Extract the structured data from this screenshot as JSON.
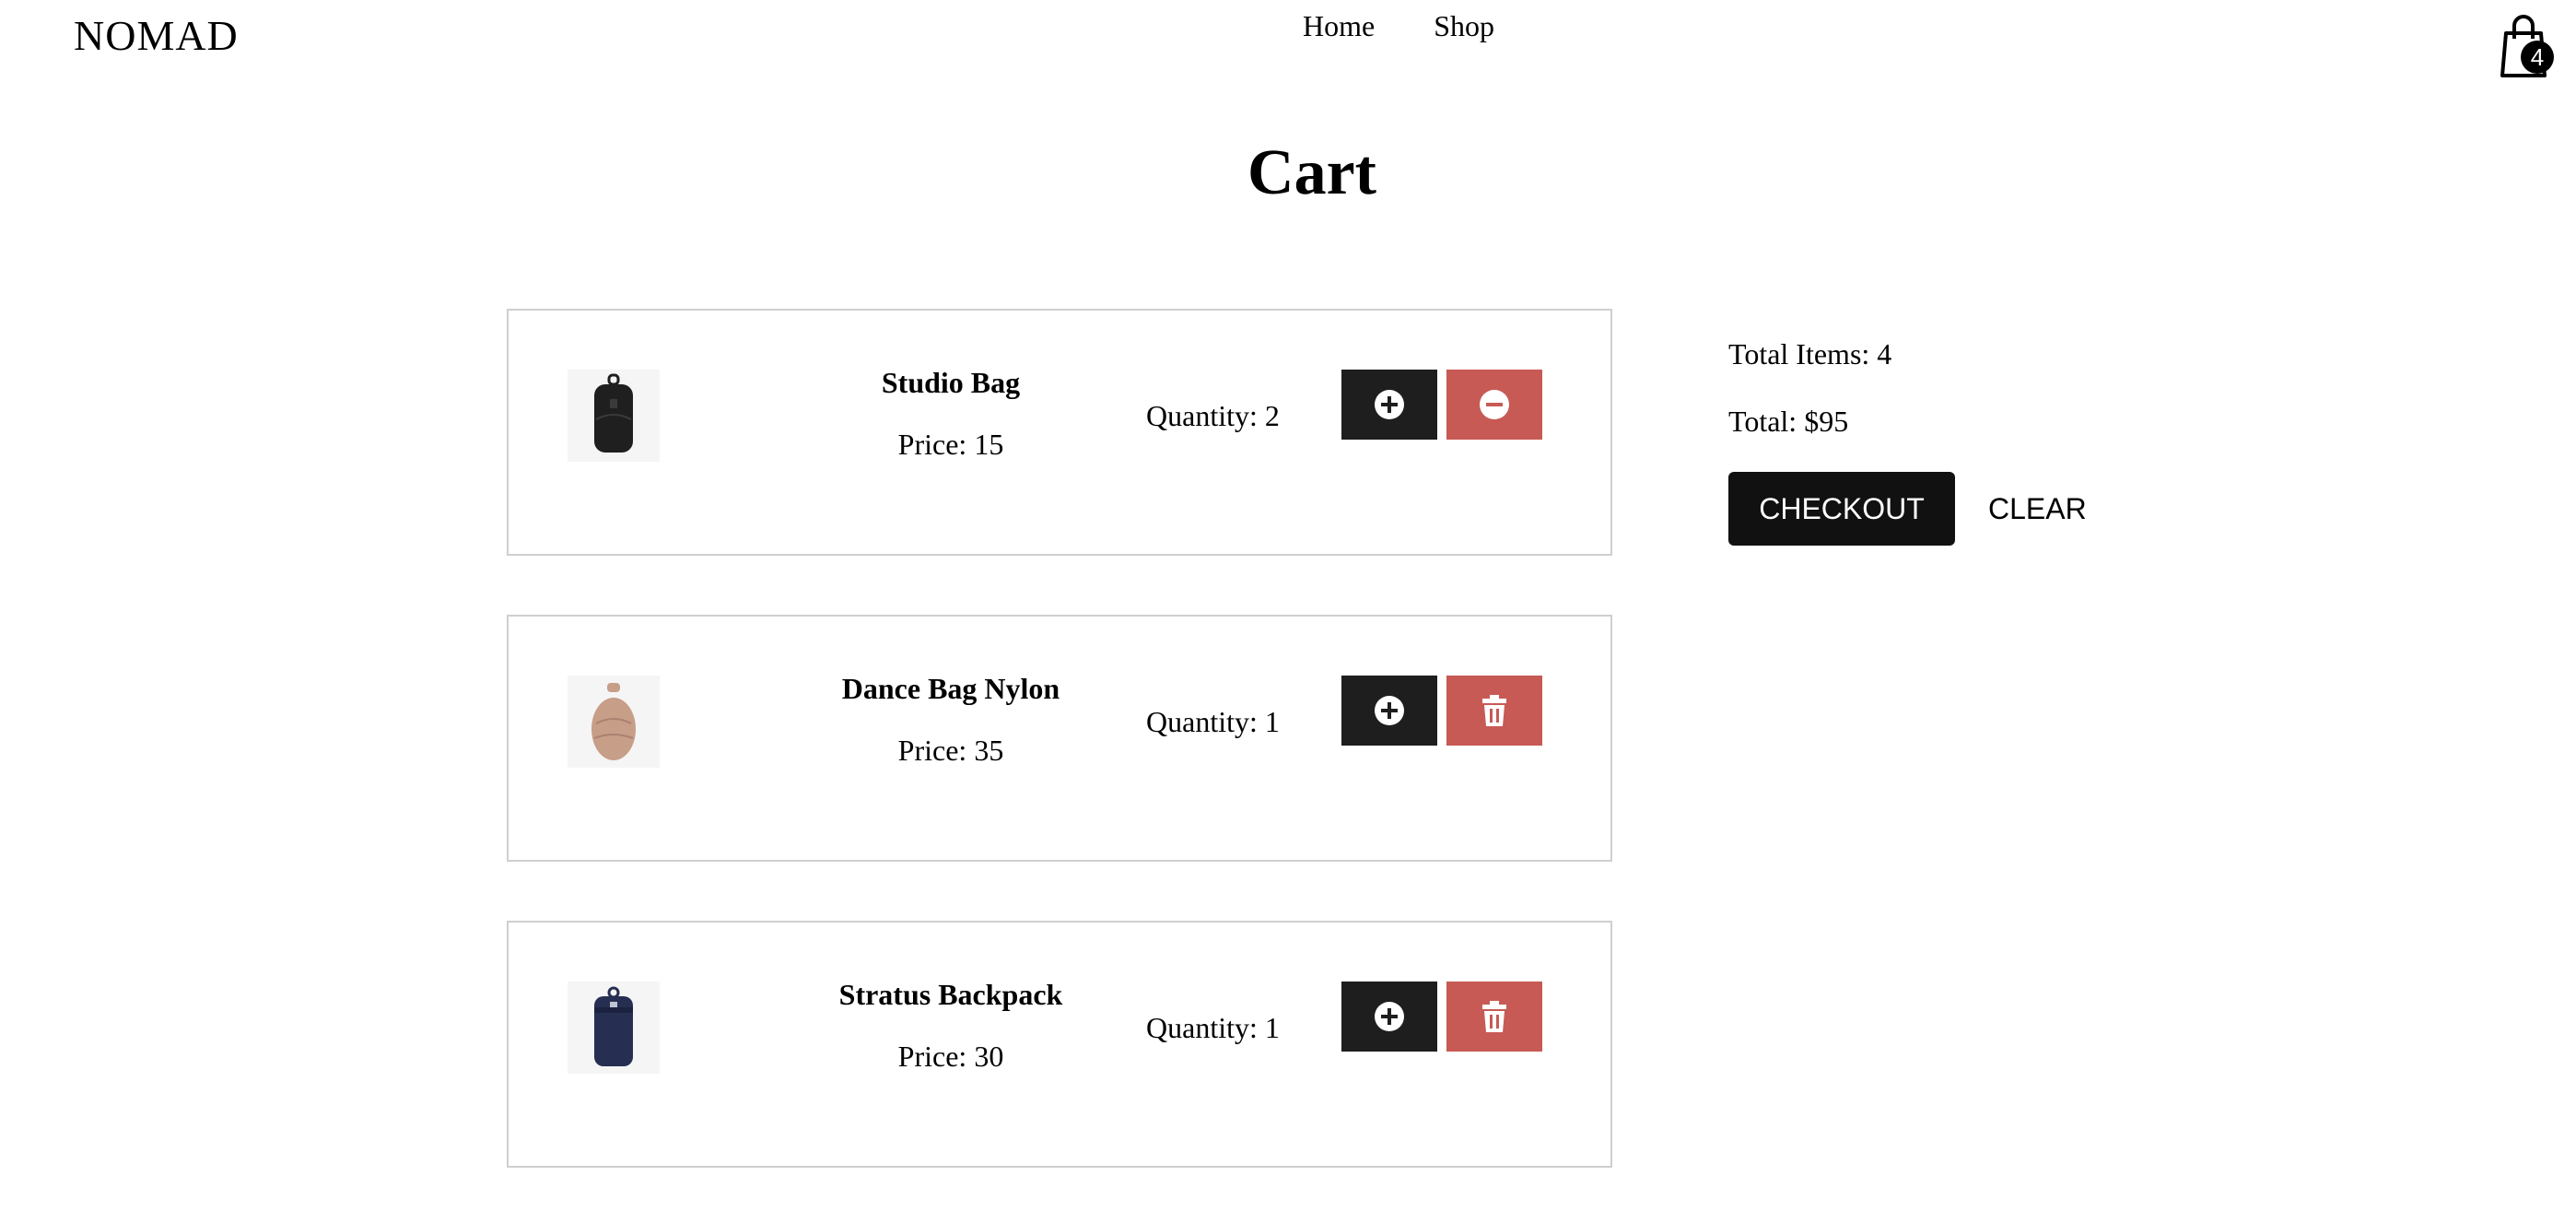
{
  "header": {
    "brand": "NOMAD",
    "nav": [
      {
        "label": "Home"
      },
      {
        "label": "Shop"
      }
    ],
    "cart_count": "4",
    "cart_icon": "shopping-bag-icon"
  },
  "page": {
    "title": "Cart"
  },
  "cart_items": [
    {
      "name": "Studio Bag",
      "price": "Price: 15",
      "quantity": "Quantity: 2",
      "image_color": "#1f1f1f",
      "increase_icon": "plus-circle-icon",
      "decrease_icon": "minus-circle-icon"
    },
    {
      "name": "Dance Bag Nylon",
      "price": "Price: 35",
      "quantity": "Quantity: 1",
      "image_color": "#c79e88",
      "increase_icon": "plus-circle-icon",
      "decrease_icon": "trash-icon"
    },
    {
      "name": "Stratus Backpack",
      "price": "Price: 30",
      "quantity": "Quantity: 1",
      "image_color": "#262f52",
      "increase_icon": "plus-circle-icon",
      "decrease_icon": "trash-icon"
    }
  ],
  "summary": {
    "total_items": "Total Items: 4",
    "total": "Total: $95",
    "checkout_label": "CHECKOUT",
    "clear_label": "CLEAR"
  },
  "colors": {
    "dark_button": "#1e1e1e",
    "danger_button": "#c75a55",
    "checkout_button": "#111111"
  }
}
